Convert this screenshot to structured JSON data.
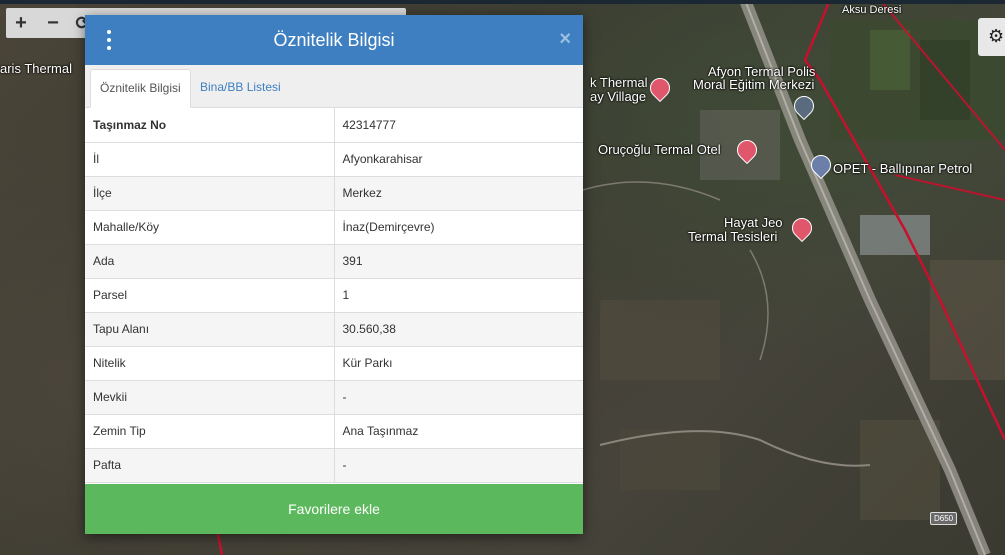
{
  "map": {
    "labels": {
      "aksu_deresi": "Aksu Deresi",
      "aris_thermal": "aris Thermal",
      "k_thermal": "k Thermal",
      "ay_village": "ay Village",
      "afyon_termal_1": "Afyon Termal Polis",
      "afyon_termal_2": "Moral Eğitim Merkezi",
      "orucoglu": "Oruçoğlu Termal Otel",
      "opet": "OPET - Ballıpınar Petrol",
      "hayat_jeo_1": "Hayat Jeo",
      "hayat_jeo_2": "Termal Tesisleri",
      "road": "D650"
    },
    "controls": {
      "zoom_in": "+",
      "zoom_out": "−",
      "refresh": "⟳",
      "settings": "⚙"
    }
  },
  "dialog": {
    "title": "Öznitelik Bilgisi",
    "close": "×",
    "tabs": [
      "Öznitelik Bilgisi",
      "Bina/BB Listesi"
    ],
    "rows": [
      {
        "key": "Taşınmaz No",
        "value": "42314777"
      },
      {
        "key": "İl",
        "value": "Afyonkarahisar"
      },
      {
        "key": "İlçe",
        "value": "Merkez"
      },
      {
        "key": "Mahalle/Köy",
        "value": "İnaz(Demirçevre)"
      },
      {
        "key": "Ada",
        "value": "391"
      },
      {
        "key": "Parsel",
        "value": "1"
      },
      {
        "key": "Tapu Alanı",
        "value": "30.560,38"
      },
      {
        "key": "Nitelik",
        "value": "Kür Parkı"
      },
      {
        "key": "Mevkii",
        "value": "-"
      },
      {
        "key": "Zemin Tip",
        "value": "Ana Taşınmaz"
      },
      {
        "key": "Pafta",
        "value": "-"
      }
    ],
    "favorite_button": "Favorilere ekle"
  },
  "colors": {
    "header": "#3e7fc1",
    "button": "#5cb85c",
    "parcel_line": "#c8102e"
  }
}
